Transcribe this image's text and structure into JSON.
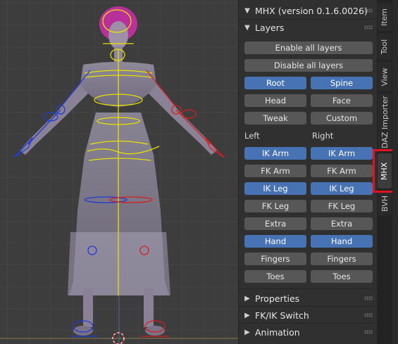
{
  "mhx_panel": {
    "title": "MHX (version 0.1.6.0026)"
  },
  "layers_panel": {
    "title": "Layers",
    "enable_all": "Enable all layers",
    "disable_all": "Disable all layers",
    "rows": [
      {
        "left": {
          "label": "Root",
          "active": true
        },
        "right": {
          "label": "Spine",
          "active": true
        }
      },
      {
        "left": {
          "label": "Head",
          "active": false
        },
        "right": {
          "label": "Face",
          "active": false
        }
      },
      {
        "left": {
          "label": "Tweak",
          "active": false
        },
        "right": {
          "label": "Custom",
          "active": false
        }
      }
    ],
    "left_heading": "Left",
    "right_heading": "Right",
    "side_rows": [
      {
        "left": {
          "label": "IK Arm",
          "active": true
        },
        "right": {
          "label": "IK Arm",
          "active": true
        }
      },
      {
        "left": {
          "label": "FK Arm",
          "active": false
        },
        "right": {
          "label": "FK Arm",
          "active": false
        }
      },
      {
        "left": {
          "label": "IK Leg",
          "active": true
        },
        "right": {
          "label": "IK Leg",
          "active": true
        }
      },
      {
        "left": {
          "label": "FK Leg",
          "active": false
        },
        "right": {
          "label": "FK Leg",
          "active": false
        }
      },
      {
        "left": {
          "label": "Extra",
          "active": false
        },
        "right": {
          "label": "Extra",
          "active": false
        }
      },
      {
        "left": {
          "label": "Hand",
          "active": true
        },
        "right": {
          "label": "Hand",
          "active": true
        }
      },
      {
        "left": {
          "label": "Fingers",
          "active": false
        },
        "right": {
          "label": "Fingers",
          "active": false
        }
      },
      {
        "left": {
          "label": "Toes",
          "active": false
        },
        "right": {
          "label": "Toes",
          "active": false
        }
      }
    ]
  },
  "collapsed_panels": [
    "Properties",
    "FK/IK Switch",
    "Animation"
  ],
  "tabs": [
    "Item",
    "Tool",
    "View",
    "DAZ Importer",
    "MHX",
    "BVH"
  ],
  "active_tab": "MHX",
  "colors": {
    "active_button": "#4772b3",
    "button": "#575757",
    "highlight": "#e0141e",
    "left_bones": "#1f3cd6",
    "right_bones": "#d81e1e",
    "center_bones": "#e8e000"
  }
}
